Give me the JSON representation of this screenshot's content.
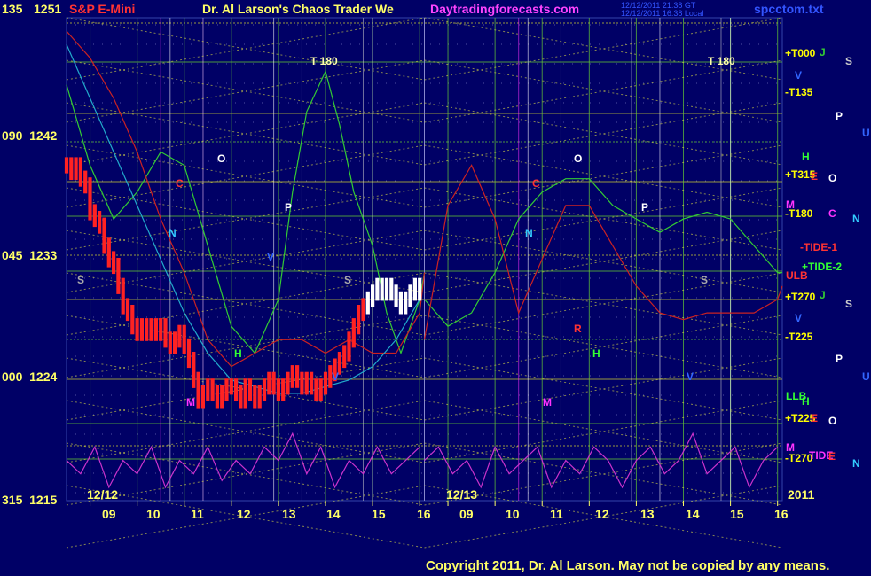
{
  "header": {
    "left_label": "135",
    "left_price": "1251",
    "symbol": "S&P E-Mini",
    "title": "Dr. Al Larson's Chaos Trader We",
    "site": "Daytradingforecasts.com",
    "stamp_line1": "12/12/2011 21:38 GT",
    "stamp_line2": "12/12/2011 16:38 Local",
    "filename": "spcctom.txt"
  },
  "y_axis": {
    "labels": [
      {
        "angle": "135",
        "price": "1251"
      },
      {
        "angle": "090",
        "price": "1242"
      },
      {
        "angle": "045",
        "price": "1233"
      },
      {
        "angle": "000",
        "price": "1224"
      },
      {
        "angle": "315",
        "price": "1215"
      }
    ]
  },
  "x_axis": {
    "hours": [
      "09",
      "10",
      "11",
      "12",
      "13",
      "14",
      "15",
      "16",
      "09",
      "10",
      "11",
      "12",
      "13",
      "14",
      "15",
      "16"
    ],
    "date_labels": [
      "12/12",
      "12/13"
    ],
    "year": "2011"
  },
  "right_labels": [
    {
      "text": "+T000",
      "color": "#ffff00"
    },
    {
      "text": "-T135",
      "color": "#ffff00"
    },
    {
      "text": "+T315",
      "color": "#ffff00"
    },
    {
      "text": "-T180",
      "color": "#ffff00"
    },
    {
      "text": "-TIDE-1",
      "color": "#ff3333"
    },
    {
      "text": "+TIDE-2",
      "color": "#33ff33"
    },
    {
      "text": "ULB",
      "color": "#ff3333"
    },
    {
      "text": "+T270",
      "color": "#ffff00"
    },
    {
      "text": "-T225",
      "color": "#ffff00"
    },
    {
      "text": "LLB",
      "color": "#33ff33"
    },
    {
      "text": "+T225",
      "color": "#ffff00"
    },
    {
      "text": "-T270",
      "color": "#ffff00"
    },
    {
      "text": "TIDE",
      "color": "#ff33ff"
    }
  ],
  "planet_markers": [
    {
      "text": "J",
      "color": "#33cc33"
    },
    {
      "text": "S",
      "color": "#cccccc"
    },
    {
      "text": "V",
      "color": "#3366ff"
    },
    {
      "text": "P",
      "color": "#ffffff"
    },
    {
      "text": "U",
      "color": "#3366ff"
    },
    {
      "text": "H",
      "color": "#33ff33"
    },
    {
      "text": "E",
      "color": "#ff3333"
    },
    {
      "text": "O",
      "color": "#ffffff"
    },
    {
      "text": "M",
      "color": "#ff33ff"
    },
    {
      "text": "C",
      "color": "#ff33ff"
    },
    {
      "text": "N",
      "color": "#33ccff"
    },
    {
      "text": "J",
      "color": "#33cc33"
    },
    {
      "text": "S",
      "color": "#cccccc"
    },
    {
      "text": "V",
      "color": "#3366ff"
    },
    {
      "text": "P",
      "color": "#ffffff"
    },
    {
      "text": "U",
      "color": "#3366ff"
    },
    {
      "text": "H",
      "color": "#33ff33"
    },
    {
      "text": "E",
      "color": "#ff3333"
    },
    {
      "text": "O",
      "color": "#ffffff"
    },
    {
      "text": "M",
      "color": "#ff33ff"
    },
    {
      "text": "E",
      "color": "#ff3333"
    },
    {
      "text": "N",
      "color": "#33ccff"
    }
  ],
  "chart_annotations": [
    {
      "text": "T 180",
      "color": "#ffffaa"
    },
    {
      "text": "T 180",
      "color": "#ffffaa"
    },
    {
      "text": "O",
      "color": "#ffffff"
    },
    {
      "text": "O",
      "color": "#ffffff"
    },
    {
      "text": "C",
      "color": "#ff3333"
    },
    {
      "text": "C",
      "color": "#ff3333"
    },
    {
      "text": "N",
      "color": "#33ccff"
    },
    {
      "text": "N",
      "color": "#33ccff"
    },
    {
      "text": "P",
      "color": "#ffffff"
    },
    {
      "text": "P",
      "color": "#ffffff"
    },
    {
      "text": "S",
      "color": "#aaaaaa"
    },
    {
      "text": "S",
      "color": "#aaaaaa"
    },
    {
      "text": "S",
      "color": "#aaaaaa"
    },
    {
      "text": "H",
      "color": "#33ff33"
    },
    {
      "text": "H",
      "color": "#33ff33"
    },
    {
      "text": "M",
      "color": "#ff33ff"
    },
    {
      "text": "M",
      "color": "#ff33ff"
    },
    {
      "text": "R",
      "color": "#ff3333"
    },
    {
      "text": "V",
      "color": "#3366ff"
    },
    {
      "text": "V",
      "color": "#3366ff"
    },
    {
      "text": "V",
      "color": "#3366ff"
    }
  ],
  "copyright": "Copyright 2011, Dr. Al Larson. May not be copied by any means.",
  "chart_data": {
    "type": "line",
    "ylim": [
      1215,
      1251
    ],
    "y_ticks": [
      1215,
      1224,
      1233,
      1242,
      1251
    ],
    "x_range_hours": [
      8.5,
      16.1
    ],
    "days": 2,
    "grid": true,
    "series": [
      {
        "name": "S&P E-Mini",
        "color": "#ff2222",
        "hilite": "#ffffff",
        "x": [
          8.5,
          8.6,
          8.7,
          8.8,
          8.9,
          9.0,
          9.1,
          9.2,
          9.3,
          9.4,
          9.5,
          9.6,
          9.7,
          9.8,
          9.9,
          10.0,
          10.1,
          10.2,
          10.3,
          10.4,
          10.5,
          10.6,
          10.7,
          10.8,
          10.9,
          11.0,
          11.1,
          11.2,
          11.3,
          11.4,
          11.5,
          11.6,
          11.7,
          11.8,
          11.9,
          12.0,
          12.1,
          12.2,
          12.3,
          12.4,
          12.5,
          12.6,
          12.7,
          12.8,
          12.9,
          13.0,
          13.1,
          13.2,
          13.3,
          13.4,
          13.5,
          13.6,
          13.7,
          13.8,
          13.9,
          14.0,
          14.1,
          14.2,
          14.3,
          14.4,
          14.5,
          14.6,
          14.7,
          14.8,
          14.9,
          15.0,
          15.1,
          15.2,
          15.3,
          15.4,
          15.5,
          15.6,
          15.7,
          15.8,
          15.9,
          16.0
        ],
        "values": [
          1240,
          1239.5,
          1240,
          1239,
          1238.5,
          1236.5,
          1236,
          1235.5,
          1234,
          1233,
          1232.5,
          1231,
          1229.5,
          1229,
          1228,
          1227.5,
          1228,
          1227.5,
          1228,
          1227.5,
          1228,
          1227,
          1226.5,
          1227,
          1227.5,
          1226.5,
          1225.5,
          1224,
          1222.5,
          1223,
          1223.5,
          1223,
          1222.5,
          1223,
          1223.5,
          1223.5,
          1223,
          1222.5,
          1223.5,
          1223,
          1222.5,
          1223,
          1223.5,
          1224,
          1223.5,
          1223,
          1223.5,
          1224,
          1224.5,
          1224,
          1223.5,
          1224,
          1223.5,
          1223,
          1223.5,
          1224,
          1224.5,
          1225,
          1225.5,
          1226,
          1227,
          1228,
          1229,
          1229.5,
          1230,
          1230.5,
          1231,
          1230.5,
          1231,
          1230.5,
          1230,
          1229.5,
          1230,
          1230.5,
          1231,
          1230.5
        ]
      },
      {
        "name": "",
        "color": "#33cc33",
        "x": [
          8.5,
          9.0,
          9.5,
          10.0,
          10.5,
          11.0,
          11.5,
          12.0,
          12.5,
          13.0,
          13.3,
          13.6,
          14.0,
          14.3,
          14.6,
          15.0,
          15.3,
          15.6,
          16.0,
          16.1
        ],
        "values": [
          1246,
          1240,
          1236,
          1238,
          1241,
          1240,
          1234,
          1228,
          1226,
          1230,
          1238,
          1244,
          1247,
          1243,
          1238,
          1234,
          1229,
          1226,
          1230,
          1232
        ]
      },
      {
        "name": "",
        "color": "#cc2222",
        "x": [
          8.5,
          9.0,
          9.5,
          10.0,
          10.5,
          11.0,
          11.5,
          12.0,
          12.5,
          13.0,
          13.5,
          14.0,
          14.5,
          15.0,
          15.5,
          16.0,
          16.1
        ],
        "values": [
          1250,
          1248,
          1245,
          1241,
          1236,
          1232,
          1227,
          1225,
          1226,
          1227,
          1227,
          1226,
          1227,
          1226,
          1226,
          1229,
          1232
        ]
      },
      {
        "name": "",
        "color": "#22aacc",
        "x": [
          8.5,
          9.0,
          9.5,
          10.0,
          10.5,
          11.0,
          11.5,
          12.0,
          12.5,
          13.0,
          13.5,
          14.0,
          14.5,
          15.0,
          15.5,
          16.0
        ],
        "values": [
          1249,
          1245,
          1241,
          1237,
          1233,
          1229,
          1226,
          1224,
          1223.5,
          1223,
          1223,
          1223.5,
          1224,
          1225,
          1227,
          1230
        ]
      },
      {
        "name": "TIDE",
        "color": "#cc33cc",
        "x": [
          8.5,
          8.8,
          9.1,
          9.4,
          9.7,
          10.0,
          10.3,
          10.6,
          10.9,
          11.2,
          11.5,
          11.8,
          12.1,
          12.4,
          12.7,
          13.0,
          13.3,
          13.6,
          13.9,
          14.2,
          14.5,
          14.8,
          15.1,
          15.4,
          15.7,
          16.0
        ],
        "values": [
          1218,
          1217,
          1219,
          1216,
          1218,
          1217,
          1219,
          1216,
          1218,
          1217,
          1219,
          1216.5,
          1218,
          1217,
          1219,
          1218,
          1220,
          1217,
          1219,
          1216,
          1218,
          1217,
          1219,
          1217,
          1218,
          1219
        ]
      },
      {
        "name": "",
        "color": "#33cc33",
        "x": [
          8.5,
          9.0,
          9.5,
          10.0,
          10.5,
          11.0,
          11.5,
          12.0,
          12.5,
          13.0,
          13.5,
          14.0,
          14.5,
          15.0,
          15.5,
          16.0,
          16.1
        ],
        "values": [
          1230,
          1228,
          1229,
          1232,
          1236,
          1238,
          1239,
          1239,
          1237,
          1236,
          1235,
          1236,
          1236.5,
          1236,
          1234,
          1232,
          1232
        ]
      },
      {
        "name": "",
        "color": "#cc2222",
        "x": [
          8.5,
          9.0,
          9.5,
          10.0,
          10.5,
          11.0,
          11.5,
          12.0,
          12.5,
          13.0,
          13.5,
          14.0,
          14.5,
          15.0,
          15.5,
          16.0,
          16.1
        ],
        "values": [
          1227,
          1237,
          1240,
          1236,
          1229,
          1233,
          1237,
          1237,
          1234,
          1231,
          1229,
          1228.5,
          1229,
          1229,
          1229,
          1230,
          1231
        ]
      },
      {
        "name": "",
        "color": "#cc33cc",
        "x": [
          8.5,
          8.8,
          9.1,
          9.4,
          9.7,
          10.0,
          10.3,
          10.6,
          10.9,
          11.2,
          11.5,
          11.8,
          12.1,
          12.4,
          12.7,
          13.0,
          13.3,
          13.6,
          13.9,
          14.2,
          14.5,
          14.8,
          15.1,
          15.4,
          15.7,
          16.0
        ],
        "values": [
          1218,
          1219,
          1217,
          1218,
          1216,
          1219,
          1217,
          1218,
          1219,
          1216,
          1218,
          1217,
          1219,
          1218,
          1216,
          1218,
          1219,
          1217,
          1218,
          1220,
          1217,
          1218,
          1219,
          1216,
          1218,
          1219
        ]
      }
    ]
  }
}
